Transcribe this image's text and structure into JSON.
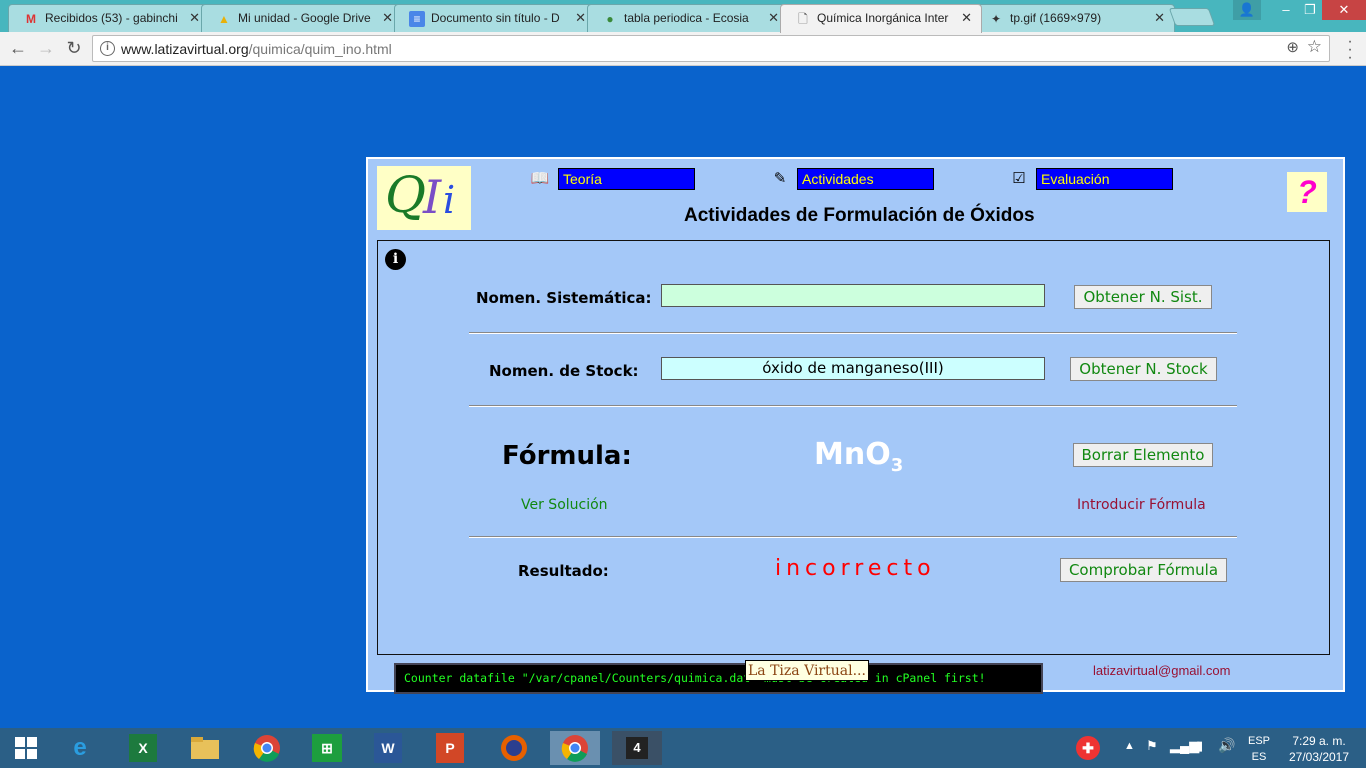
{
  "browser": {
    "tabs": [
      {
        "title": "Recibidos (53) - gabinchi",
        "icon": "gmail-icon",
        "active": false
      },
      {
        "title": "Mi unidad - Google Drive",
        "icon": "drive-icon",
        "active": false
      },
      {
        "title": "Documento sin título - D",
        "icon": "docs-icon",
        "active": false
      },
      {
        "title": "tabla periodica - Ecosia",
        "icon": "globe-icon",
        "active": false
      },
      {
        "title": "Química Inorgánica Inter",
        "icon": "page-icon",
        "active": true
      },
      {
        "title": "tp.gif (1669×979)",
        "icon": "image-icon",
        "active": false
      }
    ],
    "url_host": "www.latizavirtual.org",
    "url_path": "/quimica/quim_ino.html"
  },
  "page": {
    "nav": {
      "teoria": "Teoría",
      "actividades": "Actividades",
      "evaluacion": "Evaluación"
    },
    "help_symbol": "?",
    "title": "Actividades de Formulación de Óxidos",
    "info_symbol": "i",
    "sistematica": {
      "label": "Nomen. Sistemática:",
      "value": "",
      "button": "Obtener N. Sist."
    },
    "stock": {
      "label": "Nomen. de Stock:",
      "value": "óxido de manganeso(III)",
      "button": "Obtener N. Stock"
    },
    "formula": {
      "label": "Fórmula:",
      "base": "MnO",
      "subscript": "3",
      "button": "Borrar Elemento"
    },
    "links": {
      "ver_solucion": "Ver Solución",
      "introducir": "Introducir Fórmula"
    },
    "resultado": {
      "label": "Resultado:",
      "value": "incorrecto",
      "button": "Comprobar Fórmula"
    },
    "counter_text": "Counter datafile \"/var/cpanel/Counters/quimica.dat\" must be created in cPanel first!",
    "tooltip": "La Tiza Virtual...",
    "email": "latizavirtual@gmail.com"
  },
  "taskbar": {
    "lang_top": "ESP",
    "lang_bottom": "ES",
    "time": "7:29 a. m.",
    "date": "27/03/2017"
  },
  "colors": {
    "page_bg": "#0a63cc",
    "panel_bg": "#a4c8f8",
    "nav_bg": "#0000ff",
    "nav_text": "#ffff00",
    "result_text": "#ff0000",
    "button_text": "#118811"
  }
}
